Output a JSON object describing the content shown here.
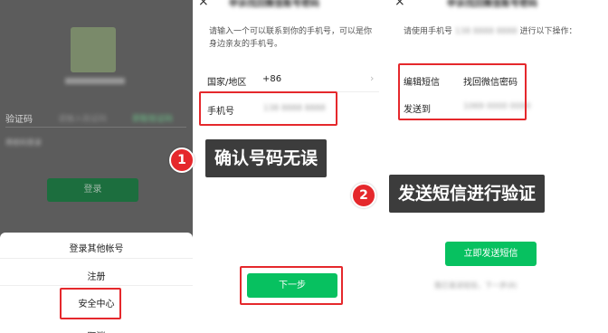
{
  "panel1": {
    "verify_label": "验证码",
    "verify_placeholder": "请输入验证码",
    "get_code_button": "获取验证码",
    "code_login_link": "用密码登录",
    "login_button": "登录",
    "sheet": [
      "登录其他帐号",
      "注册",
      "安全中心",
      "取消"
    ]
  },
  "panel2": {
    "title": "申诉找回微信账号密码",
    "description": "请输入一个可以联系到你的手机号，可以是你身边亲友的手机号。",
    "country_label": "国家/地区",
    "country_code": "+86",
    "phone_label": "手机号",
    "phone_value": "138 8888 8888",
    "next_button": "下一步"
  },
  "panel3": {
    "title": "申诉找回微信账号密码",
    "instruction_prefix": "请使用手机号",
    "instruction_number": "138 8888 8888",
    "instruction_suffix": "进行以下操作：",
    "sms_edit_label": "编辑短信",
    "sms_edit_value": "找回微信密码",
    "send_to_label": "发送到",
    "send_to_value": "1069 0000 0000",
    "send_sms_button": "立即发送短信",
    "sent_link": "我已发送短信，下一步(8)"
  },
  "callouts": [
    {
      "number": "1",
      "text": "确认号码无误"
    },
    {
      "number": "2",
      "text": "发送短信进行验证"
    }
  ],
  "colors": {
    "accent_green": "#07c160",
    "highlight_red": "#e5282c",
    "callout_bg": "#3c3c3c"
  }
}
